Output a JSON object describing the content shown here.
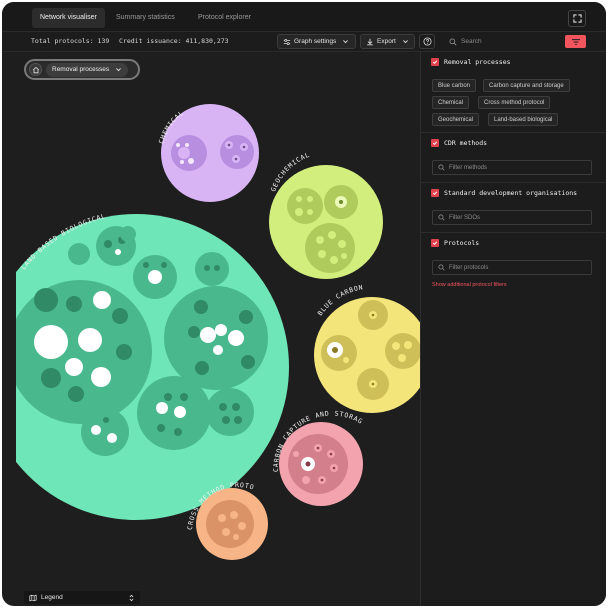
{
  "tabs": [
    {
      "label": "Network visualiser",
      "active": true
    },
    {
      "label": "Summary statistics",
      "active": false
    },
    {
      "label": "Protocol explorer",
      "active": false
    }
  ],
  "stats": {
    "total_protocols": "Total protocols: 139",
    "credit_issuance": "Credit issuance: 411,830,273"
  },
  "toolbar": {
    "graph_settings_label": "Graph settings",
    "export_label": "Export",
    "search_placeholder": "Search"
  },
  "canvas": {
    "process_dropdown_label": "Removal processes",
    "legend_label": "Legend",
    "clusters": [
      {
        "label": "CHEMICAL",
        "color": "#d8b4f5",
        "inner": "#b88fe0"
      },
      {
        "label": "GEOCHEMICAL",
        "color": "#d2ef7d",
        "inner": "#aecb5c"
      },
      {
        "label": "LAND-BASED BIOLOGICAL",
        "color": "#6ee6b8",
        "inner": "#49b98d"
      },
      {
        "label": "BLUE CARBON",
        "color": "#f4e57a",
        "inner": "#cfbf58"
      },
      {
        "label": "CARBON CAPTURE AND STORAGE",
        "color": "#f3a3ae",
        "inner": "#d4808c"
      },
      {
        "label": "CROSS METHOD PROTOCOL",
        "color": "#f6b487",
        "inner": "#d99367"
      }
    ]
  },
  "sidebar": {
    "removal_processes": {
      "title": "Removal processes",
      "chips": [
        "Blue carbon",
        "Carbon capture and storage",
        "Chemical",
        "Cross method protocol",
        "Geochemical",
        "Land-based biological"
      ]
    },
    "cdr_methods": {
      "title": "CDR methods",
      "placeholder": "Filter methods"
    },
    "sdo": {
      "title": "Standard development organisations",
      "placeholder": "Filter SDOs"
    },
    "protocols": {
      "title": "Protocols",
      "placeholder": "Filter protocols"
    },
    "show_more_link": "Show additional protocol filters"
  },
  "colors": {
    "accent": "#f2555e",
    "checkbox": "#e0434e",
    "background": "#1e1e1e"
  }
}
